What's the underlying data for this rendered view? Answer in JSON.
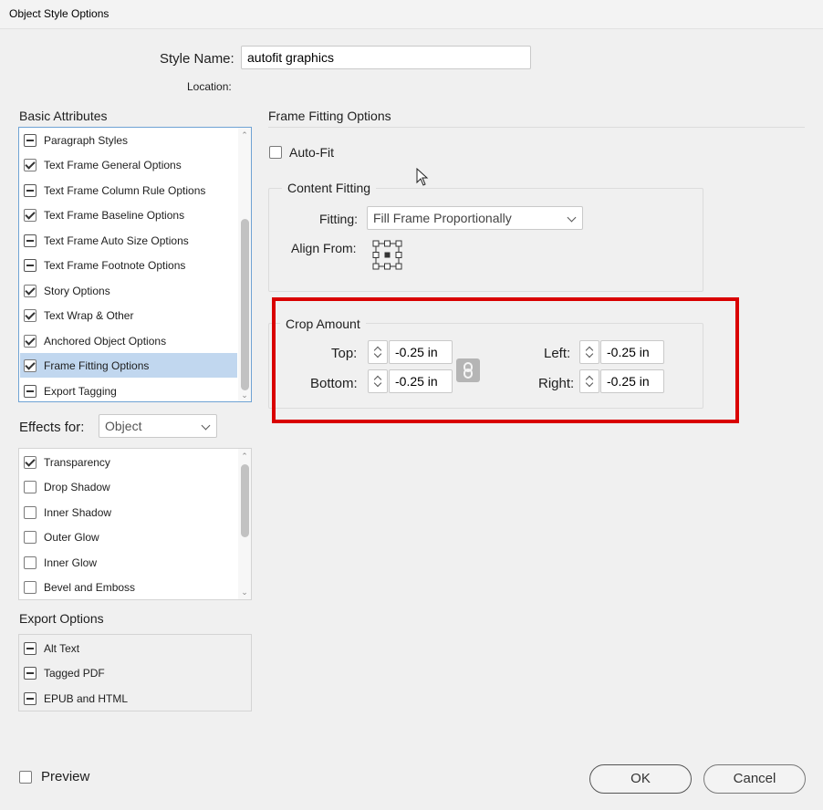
{
  "window": {
    "title": "Object Style Options"
  },
  "style_name": {
    "label": "Style Name:",
    "value": "autofit graphics"
  },
  "location": {
    "label": "Location:"
  },
  "basic_attributes": {
    "header": "Basic Attributes",
    "items": [
      {
        "label": "Paragraph Styles",
        "state": "mixed"
      },
      {
        "label": "Text Frame General Options",
        "state": "checked"
      },
      {
        "label": "Text Frame Column Rule Options",
        "state": "mixed"
      },
      {
        "label": "Text Frame Baseline Options",
        "state": "checked"
      },
      {
        "label": "Text Frame Auto Size Options",
        "state": "mixed"
      },
      {
        "label": "Text Frame Footnote Options",
        "state": "mixed"
      },
      {
        "label": "Story Options",
        "state": "checked"
      },
      {
        "label": "Text Wrap & Other",
        "state": "checked"
      },
      {
        "label": "Anchored Object Options",
        "state": "checked"
      },
      {
        "label": "Frame Fitting Options",
        "state": "checked",
        "selected": true
      },
      {
        "label": "Export Tagging",
        "state": "mixed"
      }
    ]
  },
  "effects_for": {
    "label": "Effects for:",
    "selected": "Object",
    "items": [
      {
        "label": "Transparency",
        "state": "checked"
      },
      {
        "label": "Drop Shadow",
        "state": "unchecked"
      },
      {
        "label": "Inner Shadow",
        "state": "unchecked"
      },
      {
        "label": "Outer Glow",
        "state": "unchecked"
      },
      {
        "label": "Inner Glow",
        "state": "unchecked"
      },
      {
        "label": "Bevel and Emboss",
        "state": "unchecked"
      }
    ]
  },
  "export_options": {
    "header": "Export Options",
    "items": [
      {
        "label": "Alt Text",
        "state": "mixed"
      },
      {
        "label": "Tagged PDF",
        "state": "mixed"
      },
      {
        "label": "EPUB and HTML",
        "state": "mixed"
      }
    ]
  },
  "frame_fitting": {
    "header": "Frame Fitting Options",
    "auto_fit": {
      "label": "Auto-Fit",
      "checked": false
    },
    "content_fitting": {
      "title": "Content Fitting",
      "fitting_label": "Fitting:",
      "fitting_value": "Fill Frame Proportionally",
      "align_from_label": "Align From:"
    },
    "crop_amount": {
      "title": "Crop Amount",
      "top_label": "Top:",
      "top_value": "-0.25 in",
      "bottom_label": "Bottom:",
      "bottom_value": "-0.25 in",
      "left_label": "Left:",
      "left_value": "-0.25 in",
      "right_label": "Right:",
      "right_value": "-0.25 in"
    }
  },
  "preview": {
    "label": "Preview",
    "checked": false
  },
  "buttons": {
    "ok": "OK",
    "cancel": "Cancel"
  },
  "colors": {
    "highlight": "#d90000",
    "selection": "#c1d7ef"
  }
}
